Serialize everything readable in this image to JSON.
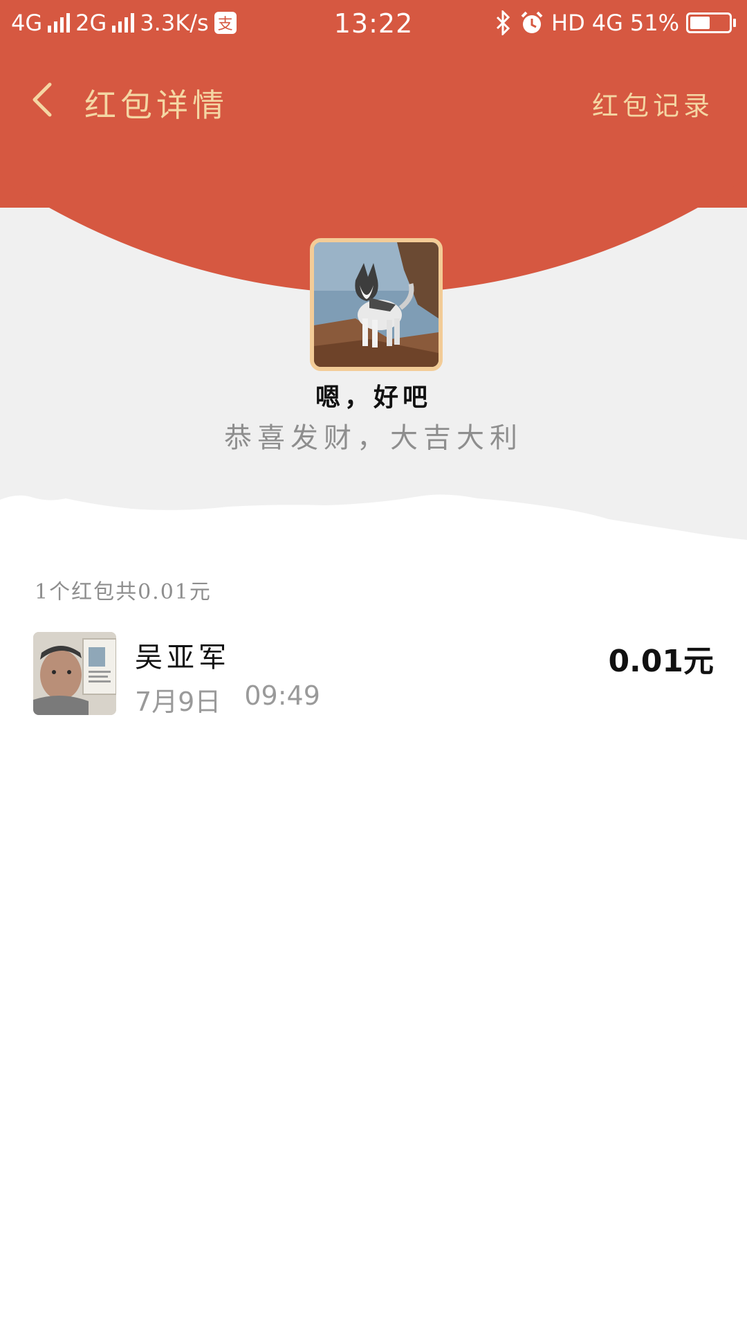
{
  "status_bar": {
    "network1": "4G",
    "network2": "2G",
    "speed": "3.3K/s",
    "app_badge": "支",
    "time": "13:22",
    "hd": "HD",
    "network3": "4G",
    "battery_percent": "51%",
    "battery_level": 0.51
  },
  "header": {
    "title": "红包详情",
    "record_link": "红包记录",
    "back_icon": "chevron-left-icon",
    "background_color": "#d65841",
    "accent_color": "#f4d6a3"
  },
  "sender": {
    "name": "嗯，好吧",
    "greeting": "恭喜发财，大吉大利"
  },
  "summary": {
    "text": "1个红包共0.01元"
  },
  "receivers": [
    {
      "name": "吴亚军",
      "date": "7月9日",
      "time": "09:49",
      "amount": "0.01元"
    }
  ]
}
